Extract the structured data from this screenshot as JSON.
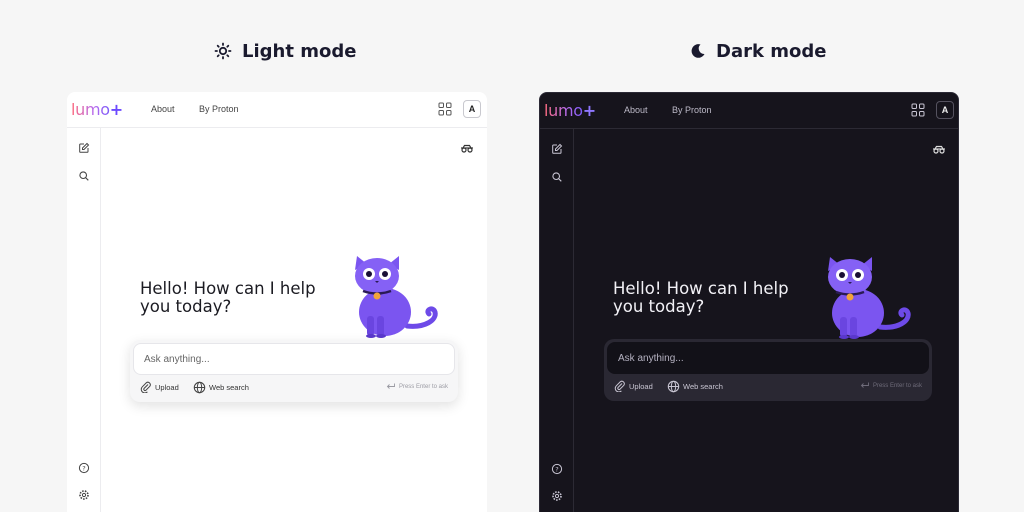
{
  "headings": {
    "light": "Light mode",
    "dark": "Dark mode"
  },
  "app": {
    "logo_word": "lumo",
    "logo_plus": "+",
    "nav": [
      "About",
      "By Proton"
    ],
    "avatar_initial": "A",
    "greeting": "Hello! How can I help you today?",
    "input_placeholder": "Ask anything...",
    "upload_label": "Upload",
    "web_search_label": "Web search",
    "send_hint": "Press Enter to ask"
  },
  "icons": [
    "sun-icon",
    "moon-icon",
    "apps-grid-icon",
    "new-chat-icon",
    "search-icon",
    "ghost-mode-icon",
    "paperclip-icon",
    "globe-icon",
    "enter-key-icon",
    "help-icon",
    "settings-icon"
  ],
  "colors": {
    "brand": "#6d4aff",
    "cat": "#7b55f0",
    "light_bg": "#ffffff",
    "dark_bg": "#16141c"
  }
}
